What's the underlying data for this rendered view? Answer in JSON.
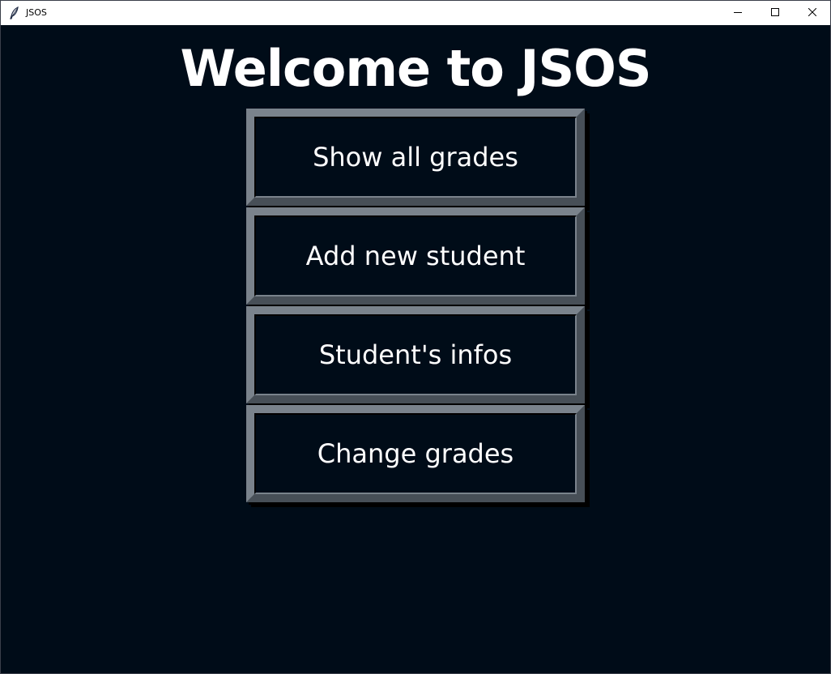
{
  "window": {
    "title": "JSOS",
    "app_icon": "feather-icon",
    "controls": {
      "minimize_icon": "minimize-icon",
      "maximize_icon": "maximize-icon",
      "close_icon": "close-icon"
    }
  },
  "main": {
    "heading": "Welcome to JSOS",
    "buttons": [
      {
        "label": "Show all grades"
      },
      {
        "label": "Add new student"
      },
      {
        "label": "Student's infos"
      },
      {
        "label": "Change grades"
      }
    ]
  },
  "colors": {
    "background": "#000c18",
    "text": "#ffffff",
    "bevel_light": "#7a838c",
    "bevel_dark": "#474f57"
  }
}
